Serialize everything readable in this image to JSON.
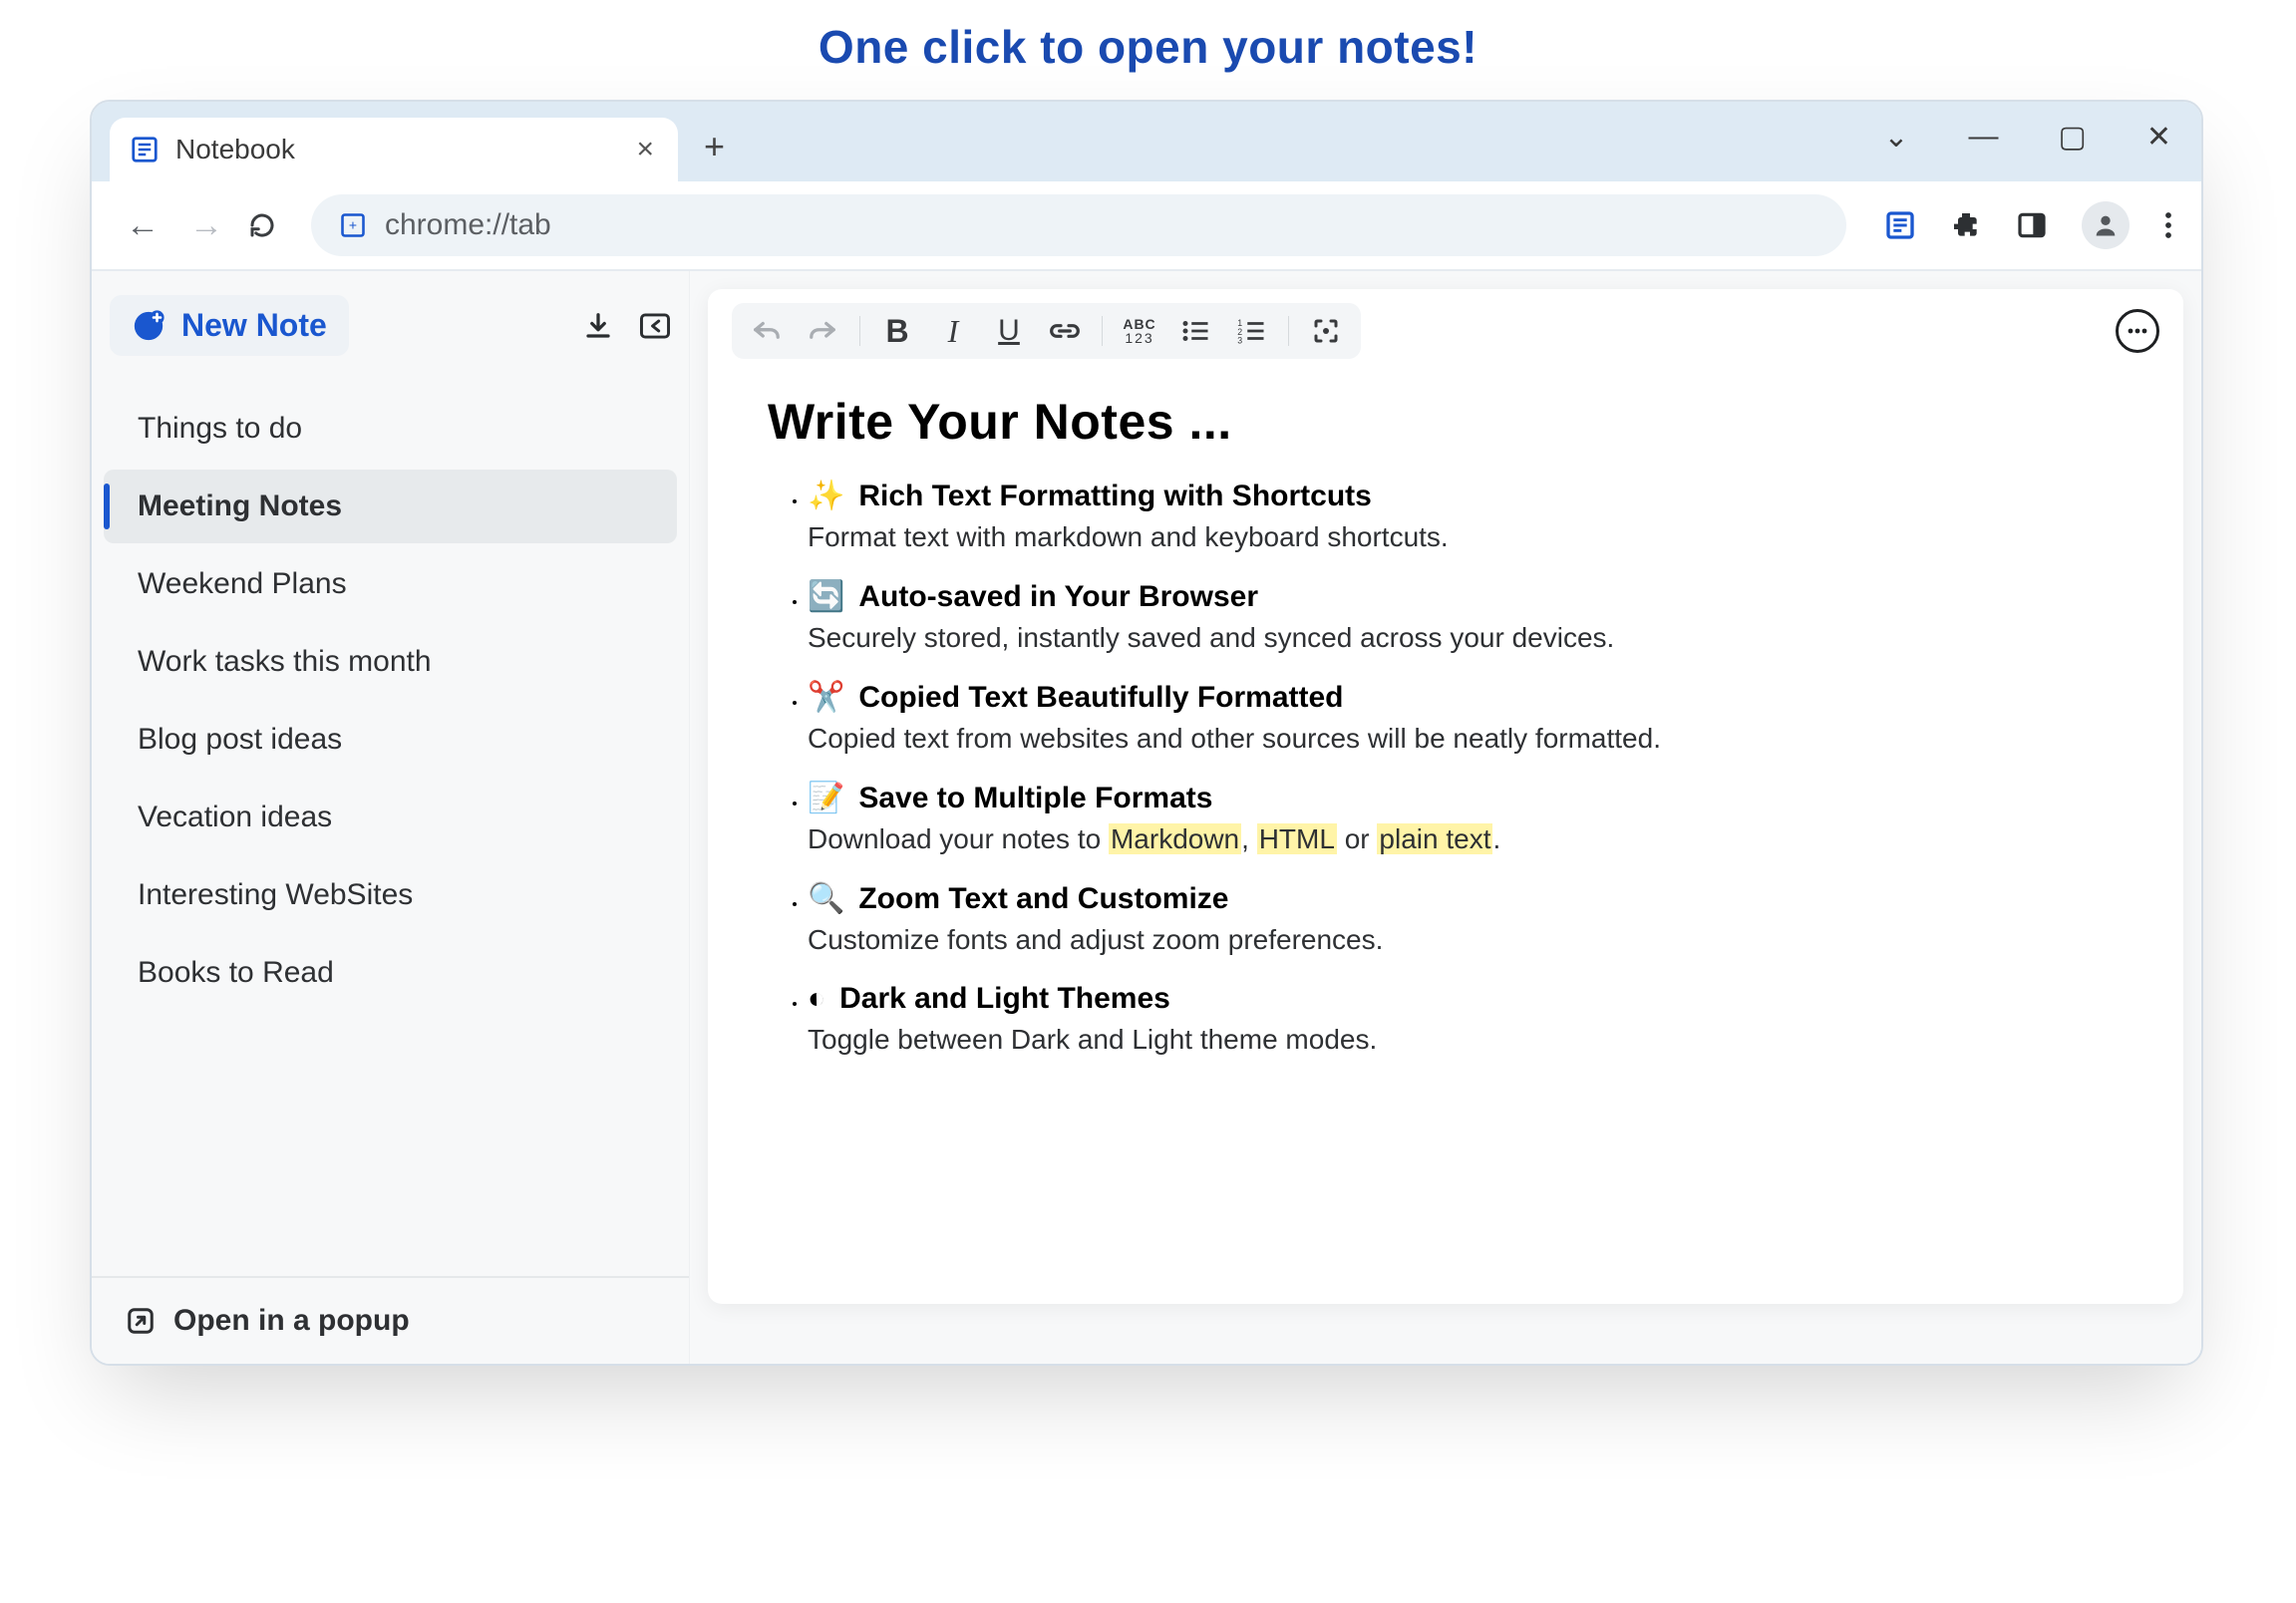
{
  "promo": {
    "headline": "One click to open your notes!"
  },
  "browser": {
    "tab_title": "Notebook",
    "url": "chrome://tab"
  },
  "window_controls": {
    "dropdown": "⌄",
    "minimize": "—",
    "maximize": "▢",
    "close": "✕"
  },
  "toolbar_icons": {
    "notebook_ext": "notebook-icon",
    "extensions": "puzzle-icon",
    "panel": "panel-icon",
    "profile": "profile-icon",
    "menu": "kebab-icon"
  },
  "sidebar": {
    "new_note_label": "New Note",
    "download_icon": "download-icon",
    "collapse_icon": "collapse-icon",
    "items": [
      {
        "label": "Things to do",
        "active": false
      },
      {
        "label": "Meeting Notes",
        "active": true
      },
      {
        "label": "Weekend Plans",
        "active": false
      },
      {
        "label": "Work tasks this month",
        "active": false
      },
      {
        "label": "Blog post ideas",
        "active": false
      },
      {
        "label": "Vecation ideas",
        "active": false
      },
      {
        "label": "Interesting WebSites",
        "active": false
      },
      {
        "label": "Books to Read",
        "active": false
      }
    ],
    "open_popup_label": "Open in a popup"
  },
  "editor": {
    "title": "Write Your Notes ...",
    "bullets": [
      {
        "emoji": "✨",
        "headline": "Rich Text Formatting with Shortcuts",
        "desc_plain": "Format text with markdown and keyboard shortcuts.",
        "desc_html": "Format text with markdown and keyboard shortcuts."
      },
      {
        "emoji": "🔄",
        "headline": "Auto-saved in Your Browser",
        "desc_plain": "Securely stored, instantly saved and synced across your devices.",
        "desc_html": "Securely stored, instantly saved and synced across your devices."
      },
      {
        "emoji": "✂️",
        "headline": "Copied Text Beautifully Formatted",
        "desc_plain": "Copied text from websites and other sources will be neatly formatted.",
        "desc_html": "Copied text from websites and other sources will be neatly formatted."
      },
      {
        "emoji": "📝",
        "headline": "Save to Multiple Formats",
        "desc_plain": "Download your notes to Markdown, HTML or plain text.",
        "desc_html": "Download your notes to <span class='hl'>Markdown</span>, <span class='hl'>HTML</span> or <span class='hl'>plain text</span>."
      },
      {
        "emoji": "🔍",
        "headline": "Zoom Text and Customize",
        "desc_plain": "Customize fonts and adjust zoom preferences.",
        "desc_html": "Customize fonts and adjust zoom preferences."
      },
      {
        "emoji": "◐",
        "headline": "Dark and Light Themes",
        "desc_plain": "Toggle between Dark and Light theme modes.",
        "desc_html": "Toggle between Dark and Light theme modes."
      }
    ],
    "highlights": [
      "Markdown",
      "HTML",
      "plain text"
    ]
  },
  "editor_toolbar": {
    "undo": "undo",
    "redo": "redo",
    "bold": "B",
    "italic": "I",
    "underline": "U",
    "link": "link",
    "spellcheck": "ABC123",
    "bulleted": "bulleted-list",
    "numbered": "numbered-list",
    "focus": "focus-mode",
    "more": "more"
  }
}
